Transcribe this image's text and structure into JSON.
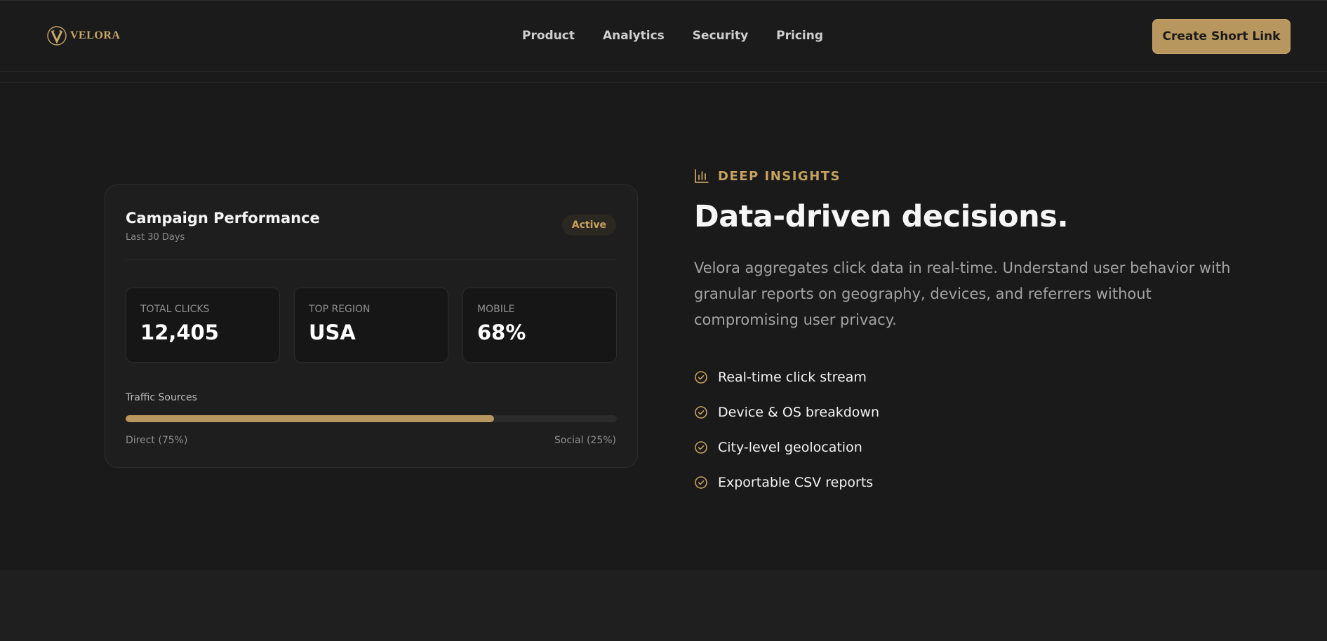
{
  "brand": {
    "name": "VELORA",
    "logo_icon": "v-monogram-icon",
    "accent_color": "#b8975e"
  },
  "nav": {
    "items": [
      "Product",
      "Analytics",
      "Security",
      "Pricing"
    ]
  },
  "header": {
    "cta_label": "Create Short Link"
  },
  "card": {
    "title": "Campaign Performance",
    "subtitle": "Last 30 Days",
    "badge": "Active",
    "stats": [
      {
        "label": "TOTAL CLICKS",
        "value": "12,405"
      },
      {
        "label": "TOP REGION",
        "value": "USA"
      },
      {
        "label": "MOBILE",
        "value": "68%"
      }
    ],
    "traffic": {
      "label": "Traffic Sources",
      "direct_fraction": 0.75,
      "left_legend": "Direct (75%)",
      "right_legend": "Social (25%)"
    }
  },
  "insights": {
    "eyebrow": "DEEP INSIGHTS",
    "eyebrow_icon": "bar-chart-icon",
    "headline": "Data-driven decisions.",
    "description": "Velora aggregates click data in real-time. Understand user behavior with granular reports on geography, devices, and referrers without compromising user privacy.",
    "feature_icon": "check-circle-icon",
    "features": [
      "Real-time click stream",
      "Device & OS breakdown",
      "City-level geolocation",
      "Exportable CSV reports"
    ]
  }
}
